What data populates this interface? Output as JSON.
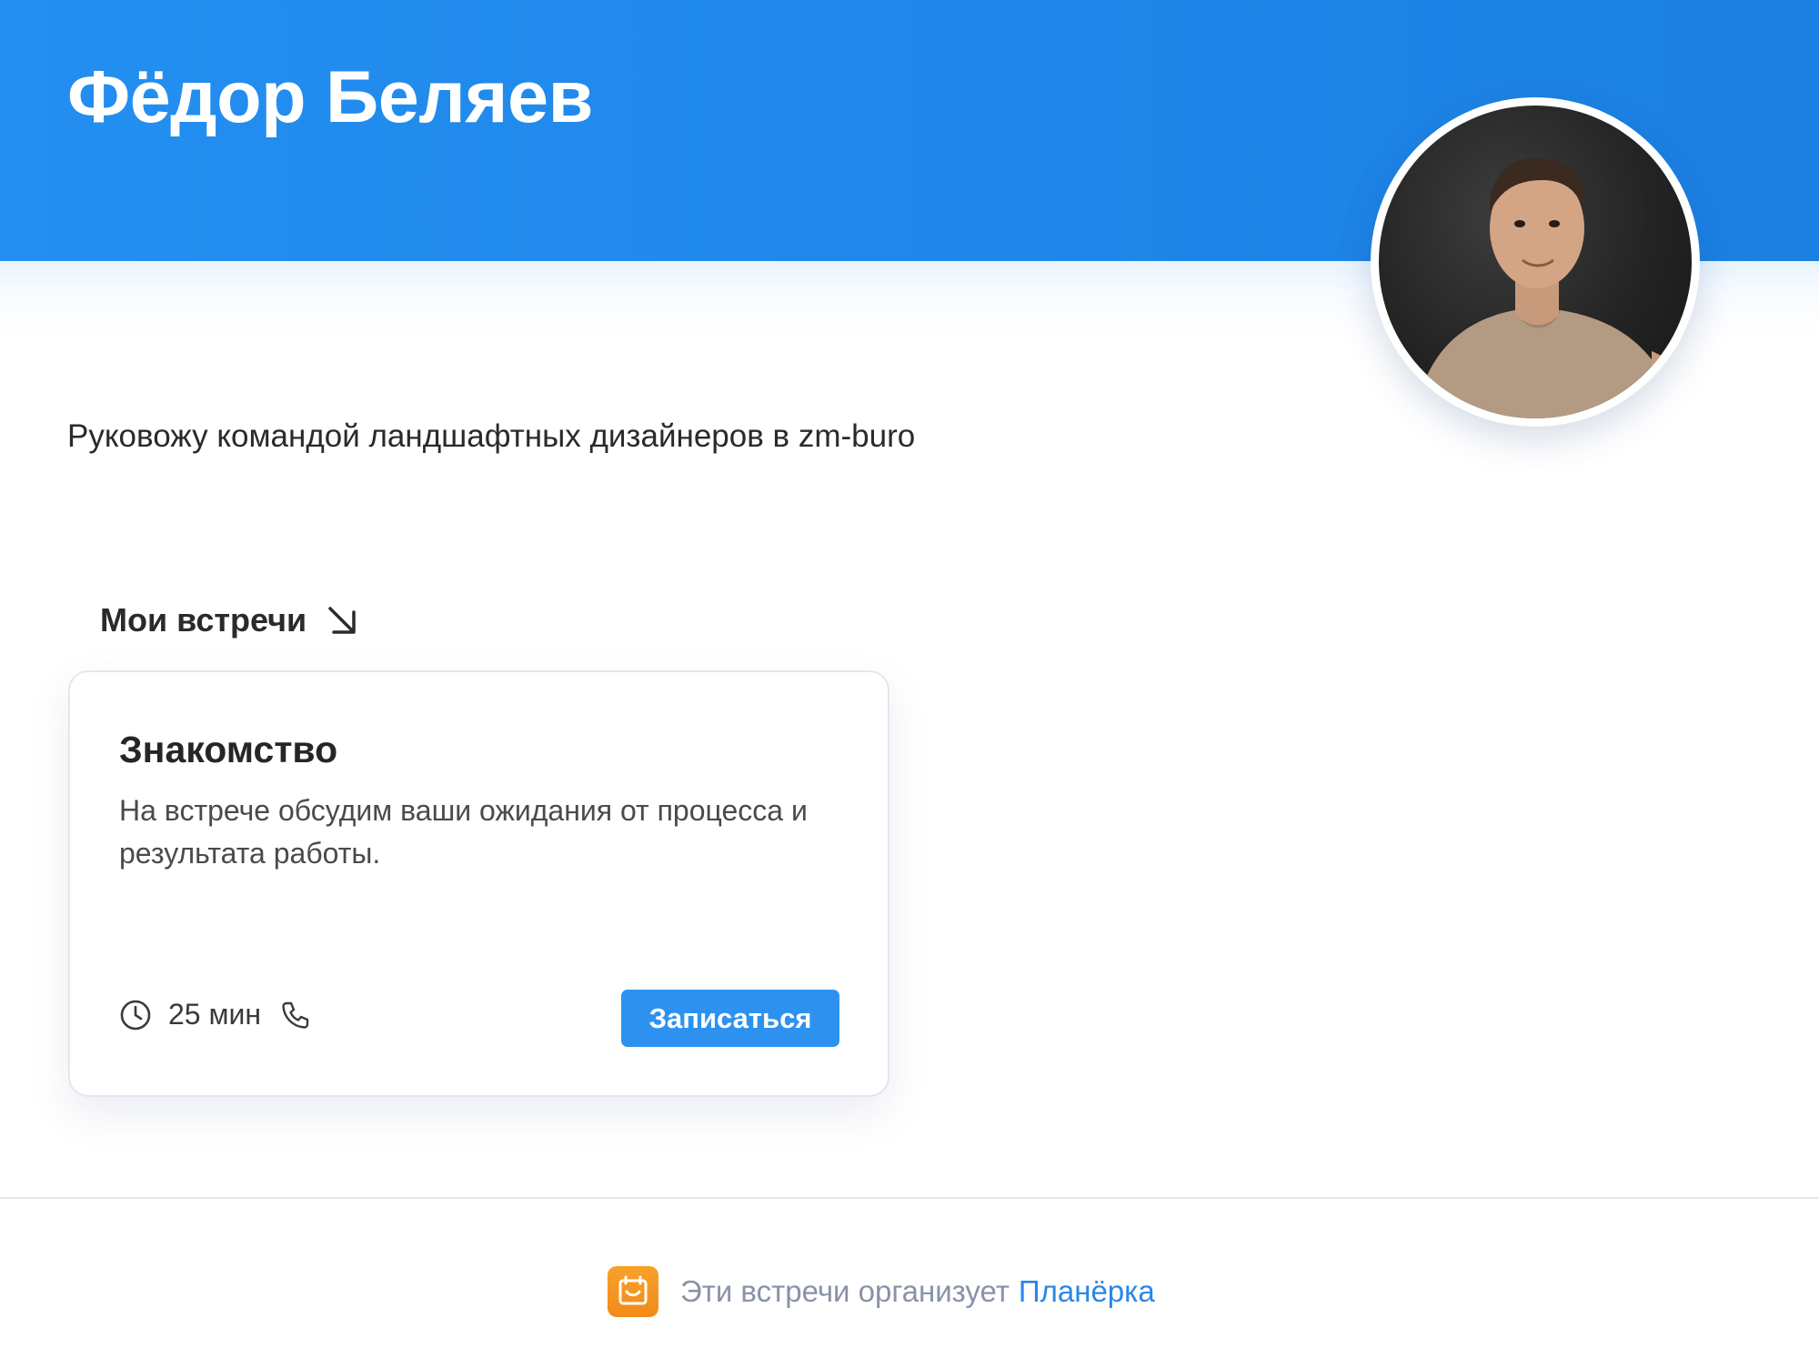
{
  "profile": {
    "name": "Фёдор Беляев",
    "bio": "Руковожу командой ландшафтных дизайнеров в zm-buro",
    "avatar_icon": "user-photo"
  },
  "meetings": {
    "section_title": "Мои встречи",
    "section_icon": "arrow-down-right-icon",
    "items": [
      {
        "title": "Знакомство",
        "description": "На встрече обсудим ваши ожидания от процесса и результата работы.",
        "duration": "25 мин",
        "duration_icon": "clock-icon",
        "call_icon": "phone-icon",
        "button_label": "Записаться"
      }
    ]
  },
  "footer": {
    "text": "Эти встречи организует",
    "link_text": "Планёрка",
    "icon": "calendar-icon"
  },
  "colors": {
    "header": "#238ff0",
    "button": "#2d92ef",
    "link": "#2a86e6",
    "footer_icon": "#f5981f"
  }
}
